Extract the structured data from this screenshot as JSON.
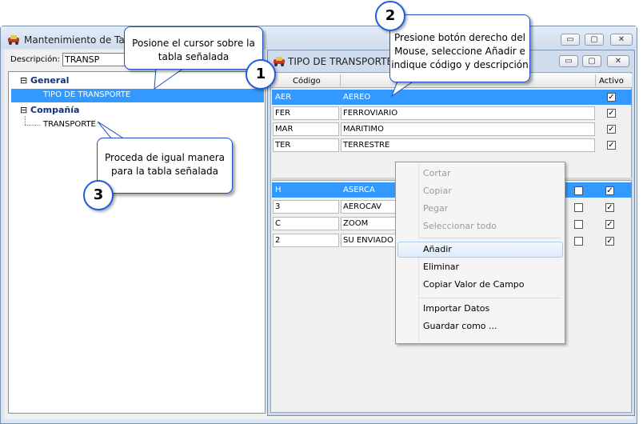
{
  "outer_window": {
    "title": "Mantenimiento de Tabl",
    "description_label": "Descripción:",
    "description_value": "TRANSP"
  },
  "tree": {
    "group1": {
      "label": "General",
      "expander": "⊟"
    },
    "group1_item": "TIPO DE TRANSPORTE",
    "group2": {
      "label": "Compañía",
      "expander": "⊟"
    },
    "group2_item": "TRANSPORTE"
  },
  "inner_window": {
    "title": "TIPO DE TRANSPORTE"
  },
  "grid1": {
    "headers": {
      "code": "Código",
      "active": "Activo"
    },
    "rows": [
      {
        "code": "AER",
        "desc": "AEREO",
        "active": "✓"
      },
      {
        "code": "FER",
        "desc": "FERROVIARIO",
        "active": "✓"
      },
      {
        "code": "MAR",
        "desc": "MARITIMO",
        "active": "✓"
      },
      {
        "code": "TER",
        "desc": "TERRESTRE",
        "active": "✓"
      }
    ]
  },
  "grid2": {
    "rows": [
      {
        "code": "H",
        "desc": "ASERCA",
        "flag": "",
        "active": "✓"
      },
      {
        "code": "3",
        "desc": "AEROCAV",
        "flag": "",
        "active": "✓"
      },
      {
        "code": "C",
        "desc": "ZOOM",
        "flag": "",
        "active": "✓"
      },
      {
        "code": "2",
        "desc": "SU ENVIADO",
        "flag": "",
        "active": "✓"
      }
    ]
  },
  "context_menu": {
    "cut": "Cortar",
    "copy": "Copiar",
    "paste": "Pegar",
    "select_all": "Seleccionar todo",
    "add": "Añadir",
    "delete": "Eliminar",
    "copy_field": "Copiar Valor de Campo",
    "import": "Importar Datos",
    "save_as": "Guardar como ..."
  },
  "callouts": {
    "one_text_a": "Posione el cursor sobre la",
    "one_text_b": "tabla señalada",
    "one_num": "1",
    "two_text_a": "Presione botón derecho del",
    "two_text_b": "Mouse, seleccione Añadir e",
    "two_text_c": "indique código y descripción",
    "two_num": "2",
    "three_text_a": "Proceda de igual manera",
    "three_text_b": "para la tabla señalada",
    "three_num": "3"
  },
  "window_buttons": {
    "minimize": "▭",
    "maximize": "▢",
    "close": "✕"
  },
  "colors": {
    "selection": "#3399ff",
    "callout_border": "#1d4ec0",
    "title_bar": "#d9e4f1"
  }
}
